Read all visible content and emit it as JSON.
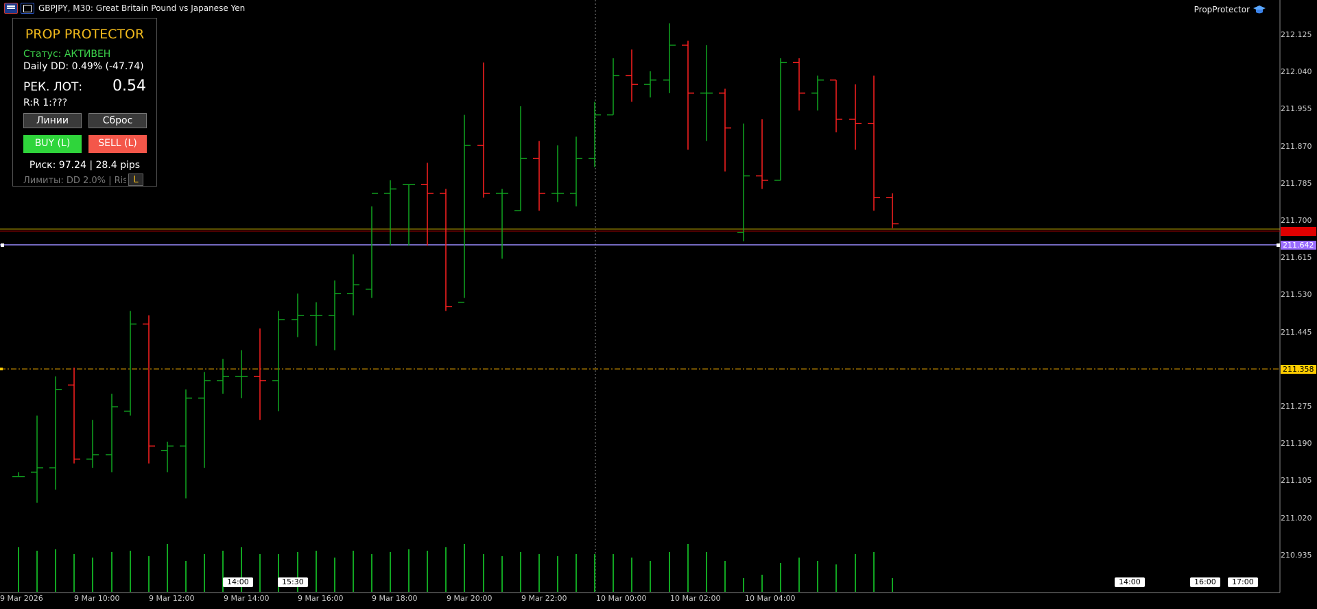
{
  "header": {
    "title": "GBPJPY, M30:  Great Britain Pound vs Japanese Yen",
    "expert_name": "PropProtector"
  },
  "panel": {
    "title": "PROP PROTECTOR",
    "status": "Статус: АКТИВЕН",
    "daily_dd": "Daily DD: 0.49% (-47.74)",
    "lot_label": "РЕК. ЛОТ:",
    "lot_value": "0.54",
    "rr": "R:R 1:???",
    "lines_button": "Линии",
    "reset_button": "Сброс",
    "buy_button": "BUY (L)",
    "sell_button": "SELL (L)",
    "risk": "Риск: 97.24 | 28.4 pips",
    "limits": "Лимиты: DD 2.0% | Risk 1",
    "lock_button": "L",
    "colors": {
      "title": "#f0b91c",
      "status": "#3cd24b",
      "buy": "#2fd53b",
      "sell": "#f4574a"
    }
  },
  "price_axis": {
    "labels": [
      "212.125",
      "212.040",
      "211.955",
      "211.870",
      "211.785",
      "211.700",
      "211.615",
      "211.530",
      "211.445",
      "211.358",
      "211.275",
      "211.190",
      "211.105",
      "211.020",
      "210.935"
    ],
    "tags": [
      {
        "value": "211.673",
        "color": "#e00000",
        "text_color": "#e00000"
      },
      {
        "value": "211.642",
        "color": "#9a6cff",
        "text_color": "#ffffff"
      },
      {
        "value": "211.358",
        "color": "#ffcc00",
        "text_color": "#000000"
      }
    ]
  },
  "time_axis": {
    "labels": [
      "9 Mar 2026",
      "9 Mar 10:00",
      "9 Mar 12:00",
      "9 Mar 14:00",
      "9 Mar 16:00",
      "9 Mar 18:00",
      "9 Mar 20:00",
      "9 Mar 22:00",
      "10 Mar 00:00",
      "10 Mar 02:00",
      "10 Mar 04:00"
    ],
    "separators": [
      "14:00",
      "15:30",
      "14:00",
      "16:00",
      "17:00"
    ]
  },
  "chart_data": {
    "type": "ohlc",
    "symbol": "GBPJPY",
    "timeframe": "M30",
    "colors": {
      "up": "#11a521",
      "down": "#ff2020"
    },
    "bars": [
      {
        "o": 211.11,
        "h": 211.12,
        "l": 211.11,
        "c": 211.11,
        "vol": 65
      },
      {
        "o": 211.12,
        "h": 211.25,
        "l": 211.05,
        "c": 211.13,
        "vol": 60
      },
      {
        "o": 211.13,
        "h": 211.34,
        "l": 211.08,
        "c": 211.31,
        "vol": 62
      },
      {
        "o": 211.32,
        "h": 211.36,
        "l": 211.14,
        "c": 211.15,
        "vol": 55
      },
      {
        "o": 211.15,
        "h": 211.24,
        "l": 211.13,
        "c": 211.16,
        "vol": 50
      },
      {
        "o": 211.16,
        "h": 211.3,
        "l": 211.12,
        "c": 211.27,
        "vol": 58
      },
      {
        "o": 211.26,
        "h": 211.49,
        "l": 211.25,
        "c": 211.46,
        "vol": 60
      },
      {
        "o": 211.46,
        "h": 211.48,
        "l": 211.14,
        "c": 211.18,
        "vol": 52
      },
      {
        "o": 211.17,
        "h": 211.19,
        "l": 211.12,
        "c": 211.18,
        "vol": 70
      },
      {
        "o": 211.18,
        "h": 211.31,
        "l": 211.06,
        "c": 211.29,
        "vol": 45
      },
      {
        "o": 211.29,
        "h": 211.35,
        "l": 211.13,
        "c": 211.33,
        "vol": 55
      },
      {
        "o": 211.33,
        "h": 211.38,
        "l": 211.3,
        "c": 211.34,
        "vol": 60
      },
      {
        "o": 211.34,
        "h": 211.4,
        "l": 211.29,
        "c": 211.34,
        "vol": 65
      },
      {
        "o": 211.34,
        "h": 211.45,
        "l": 211.24,
        "c": 211.33,
        "vol": 55
      },
      {
        "o": 211.33,
        "h": 211.49,
        "l": 211.26,
        "c": 211.47,
        "vol": 55
      },
      {
        "o": 211.47,
        "h": 211.53,
        "l": 211.43,
        "c": 211.48,
        "vol": 58
      },
      {
        "o": 211.48,
        "h": 211.51,
        "l": 211.41,
        "c": 211.48,
        "vol": 60
      },
      {
        "o": 211.48,
        "h": 211.56,
        "l": 211.4,
        "c": 211.53,
        "vol": 50
      },
      {
        "o": 211.53,
        "h": 211.62,
        "l": 211.48,
        "c": 211.55,
        "vol": 60
      },
      {
        "o": 211.54,
        "h": 211.73,
        "l": 211.52,
        "c": 211.76,
        "vol": 55
      },
      {
        "o": 211.76,
        "h": 211.79,
        "l": 211.64,
        "c": 211.77,
        "vol": 58
      },
      {
        "o": 211.78,
        "h": 211.78,
        "l": 211.64,
        "c": 211.78,
        "vol": 62
      },
      {
        "o": 211.78,
        "h": 211.83,
        "l": 211.64,
        "c": 211.76,
        "vol": 60
      },
      {
        "o": 211.76,
        "h": 211.77,
        "l": 211.49,
        "c": 211.5,
        "vol": 65
      },
      {
        "o": 211.51,
        "h": 211.94,
        "l": 211.52,
        "c": 211.87,
        "vol": 70
      },
      {
        "o": 211.87,
        "h": 212.06,
        "l": 211.75,
        "c": 211.76,
        "vol": 55
      },
      {
        "o": 211.76,
        "h": 211.77,
        "l": 211.61,
        "c": 211.76,
        "vol": 52
      },
      {
        "o": 211.72,
        "h": 211.96,
        "l": 211.72,
        "c": 211.84,
        "vol": 58
      },
      {
        "o": 211.84,
        "h": 211.88,
        "l": 211.72,
        "c": 211.76,
        "vol": 55
      },
      {
        "o": 211.76,
        "h": 211.87,
        "l": 211.74,
        "c": 211.76,
        "vol": 52
      },
      {
        "o": 211.76,
        "h": 211.89,
        "l": 211.73,
        "c": 211.84,
        "vol": 55
      },
      {
        "o": 211.84,
        "h": 211.97,
        "l": 211.82,
        "c": 211.94,
        "vol": 55
      },
      {
        "o": 211.94,
        "h": 212.07,
        "l": 211.94,
        "c": 212.03,
        "vol": 55
      },
      {
        "o": 212.03,
        "h": 212.09,
        "l": 211.97,
        "c": 212.01,
        "vol": 50
      },
      {
        "o": 212.01,
        "h": 212.04,
        "l": 211.98,
        "c": 212.02,
        "vol": 45
      },
      {
        "o": 212.02,
        "h": 212.15,
        "l": 211.99,
        "c": 212.1,
        "vol": 58
      },
      {
        "o": 212.1,
        "h": 212.11,
        "l": 211.86,
        "c": 211.99,
        "vol": 70
      },
      {
        "o": 211.99,
        "h": 212.1,
        "l": 211.88,
        "c": 211.99,
        "vol": 58
      },
      {
        "o": 211.99,
        "h": 212.0,
        "l": 211.81,
        "c": 211.91,
        "vol": 45
      },
      {
        "o": 211.67,
        "h": 211.92,
        "l": 211.65,
        "c": 211.8,
        "vol": 20
      },
      {
        "o": 211.8,
        "h": 211.93,
        "l": 211.77,
        "c": 211.79,
        "vol": 25
      },
      {
        "o": 211.79,
        "h": 212.07,
        "l": 211.79,
        "c": 212.06,
        "vol": 42
      },
      {
        "o": 212.06,
        "h": 212.07,
        "l": 211.95,
        "c": 211.99,
        "vol": 50
      },
      {
        "o": 211.99,
        "h": 212.03,
        "l": 211.95,
        "c": 212.02,
        "vol": 45
      },
      {
        "o": 212.02,
        "h": 212.02,
        "l": 211.9,
        "c": 211.93,
        "vol": 40
      },
      {
        "o": 211.93,
        "h": 212.01,
        "l": 211.86,
        "c": 211.92,
        "vol": 55
      },
      {
        "o": 211.92,
        "h": 212.03,
        "l": 211.72,
        "c": 211.75,
        "vol": 58
      },
      {
        "o": 211.75,
        "h": 211.76,
        "l": 211.68,
        "c": 211.69,
        "vol": 20
      }
    ]
  }
}
